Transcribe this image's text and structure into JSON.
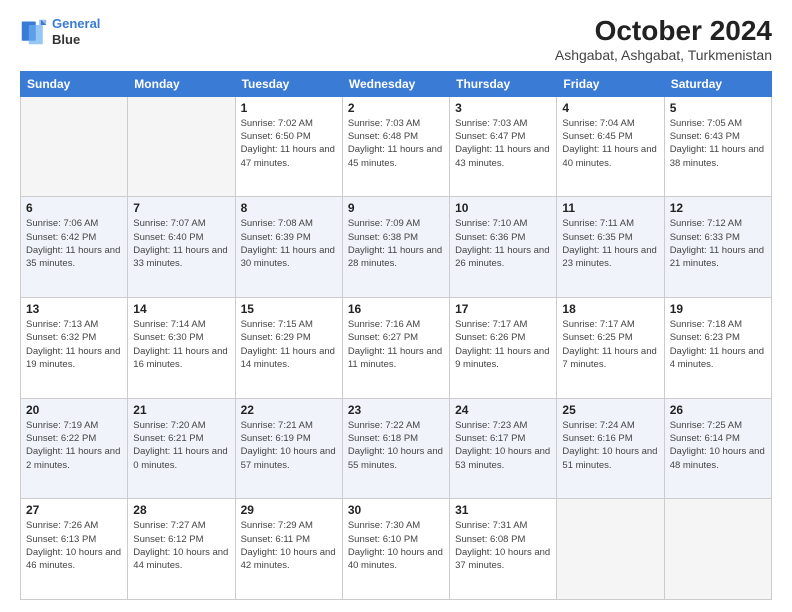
{
  "header": {
    "logo_line1": "General",
    "logo_line2": "Blue",
    "title": "October 2024",
    "subtitle": "Ashgabat, Ashgabat, Turkmenistan"
  },
  "days_of_week": [
    "Sunday",
    "Monday",
    "Tuesday",
    "Wednesday",
    "Thursday",
    "Friday",
    "Saturday"
  ],
  "weeks": [
    {
      "shaded": false,
      "days": [
        {
          "num": "",
          "info": ""
        },
        {
          "num": "",
          "info": ""
        },
        {
          "num": "1",
          "info": "Sunrise: 7:02 AM\nSunset: 6:50 PM\nDaylight: 11 hours and 47 minutes."
        },
        {
          "num": "2",
          "info": "Sunrise: 7:03 AM\nSunset: 6:48 PM\nDaylight: 11 hours and 45 minutes."
        },
        {
          "num": "3",
          "info": "Sunrise: 7:03 AM\nSunset: 6:47 PM\nDaylight: 11 hours and 43 minutes."
        },
        {
          "num": "4",
          "info": "Sunrise: 7:04 AM\nSunset: 6:45 PM\nDaylight: 11 hours and 40 minutes."
        },
        {
          "num": "5",
          "info": "Sunrise: 7:05 AM\nSunset: 6:43 PM\nDaylight: 11 hours and 38 minutes."
        }
      ]
    },
    {
      "shaded": true,
      "days": [
        {
          "num": "6",
          "info": "Sunrise: 7:06 AM\nSunset: 6:42 PM\nDaylight: 11 hours and 35 minutes."
        },
        {
          "num": "7",
          "info": "Sunrise: 7:07 AM\nSunset: 6:40 PM\nDaylight: 11 hours and 33 minutes."
        },
        {
          "num": "8",
          "info": "Sunrise: 7:08 AM\nSunset: 6:39 PM\nDaylight: 11 hours and 30 minutes."
        },
        {
          "num": "9",
          "info": "Sunrise: 7:09 AM\nSunset: 6:38 PM\nDaylight: 11 hours and 28 minutes."
        },
        {
          "num": "10",
          "info": "Sunrise: 7:10 AM\nSunset: 6:36 PM\nDaylight: 11 hours and 26 minutes."
        },
        {
          "num": "11",
          "info": "Sunrise: 7:11 AM\nSunset: 6:35 PM\nDaylight: 11 hours and 23 minutes."
        },
        {
          "num": "12",
          "info": "Sunrise: 7:12 AM\nSunset: 6:33 PM\nDaylight: 11 hours and 21 minutes."
        }
      ]
    },
    {
      "shaded": false,
      "days": [
        {
          "num": "13",
          "info": "Sunrise: 7:13 AM\nSunset: 6:32 PM\nDaylight: 11 hours and 19 minutes."
        },
        {
          "num": "14",
          "info": "Sunrise: 7:14 AM\nSunset: 6:30 PM\nDaylight: 11 hours and 16 minutes."
        },
        {
          "num": "15",
          "info": "Sunrise: 7:15 AM\nSunset: 6:29 PM\nDaylight: 11 hours and 14 minutes."
        },
        {
          "num": "16",
          "info": "Sunrise: 7:16 AM\nSunset: 6:27 PM\nDaylight: 11 hours and 11 minutes."
        },
        {
          "num": "17",
          "info": "Sunrise: 7:17 AM\nSunset: 6:26 PM\nDaylight: 11 hours and 9 minutes."
        },
        {
          "num": "18",
          "info": "Sunrise: 7:17 AM\nSunset: 6:25 PM\nDaylight: 11 hours and 7 minutes."
        },
        {
          "num": "19",
          "info": "Sunrise: 7:18 AM\nSunset: 6:23 PM\nDaylight: 11 hours and 4 minutes."
        }
      ]
    },
    {
      "shaded": true,
      "days": [
        {
          "num": "20",
          "info": "Sunrise: 7:19 AM\nSunset: 6:22 PM\nDaylight: 11 hours and 2 minutes."
        },
        {
          "num": "21",
          "info": "Sunrise: 7:20 AM\nSunset: 6:21 PM\nDaylight: 11 hours and 0 minutes."
        },
        {
          "num": "22",
          "info": "Sunrise: 7:21 AM\nSunset: 6:19 PM\nDaylight: 10 hours and 57 minutes."
        },
        {
          "num": "23",
          "info": "Sunrise: 7:22 AM\nSunset: 6:18 PM\nDaylight: 10 hours and 55 minutes."
        },
        {
          "num": "24",
          "info": "Sunrise: 7:23 AM\nSunset: 6:17 PM\nDaylight: 10 hours and 53 minutes."
        },
        {
          "num": "25",
          "info": "Sunrise: 7:24 AM\nSunset: 6:16 PM\nDaylight: 10 hours and 51 minutes."
        },
        {
          "num": "26",
          "info": "Sunrise: 7:25 AM\nSunset: 6:14 PM\nDaylight: 10 hours and 48 minutes."
        }
      ]
    },
    {
      "shaded": false,
      "days": [
        {
          "num": "27",
          "info": "Sunrise: 7:26 AM\nSunset: 6:13 PM\nDaylight: 10 hours and 46 minutes."
        },
        {
          "num": "28",
          "info": "Sunrise: 7:27 AM\nSunset: 6:12 PM\nDaylight: 10 hours and 44 minutes."
        },
        {
          "num": "29",
          "info": "Sunrise: 7:29 AM\nSunset: 6:11 PM\nDaylight: 10 hours and 42 minutes."
        },
        {
          "num": "30",
          "info": "Sunrise: 7:30 AM\nSunset: 6:10 PM\nDaylight: 10 hours and 40 minutes."
        },
        {
          "num": "31",
          "info": "Sunrise: 7:31 AM\nSunset: 6:08 PM\nDaylight: 10 hours and 37 minutes."
        },
        {
          "num": "",
          "info": ""
        },
        {
          "num": "",
          "info": ""
        }
      ]
    }
  ]
}
